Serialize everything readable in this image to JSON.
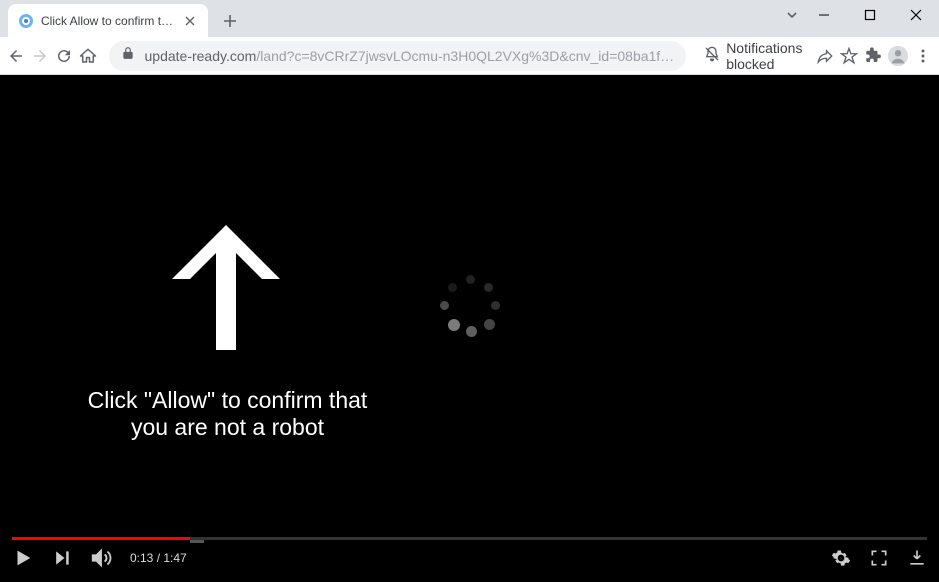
{
  "tab": {
    "title": "Click Allow to confirm that you a"
  },
  "url": {
    "host": "update-ready.com",
    "path": "/land?c=8vCRrZ7jwsvLOcmu-n3H0QL2VXg%3D&cnv_id=08ba1f…"
  },
  "notification_status": "Notifications blocked",
  "page": {
    "instruction": "Click \"Allow\" to confirm that you are not a robot"
  },
  "video": {
    "current_time": "0:13",
    "total_time": "1:47",
    "separator": " / "
  }
}
